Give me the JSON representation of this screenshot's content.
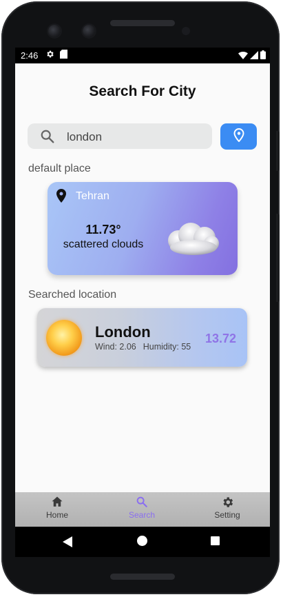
{
  "status": {
    "time": "2:46",
    "left_icons": [
      "gear-icon",
      "sd-card-icon"
    ],
    "right_icons": [
      "wifi-icon",
      "signal-icon",
      "battery-icon"
    ]
  },
  "page": {
    "title": "Search For City"
  },
  "search": {
    "value": "london",
    "icon": "search-icon",
    "location_button_icon": "location-pin-icon"
  },
  "default_place": {
    "section_label": "default place",
    "city": "Tehran",
    "temperature": "11.73°",
    "condition": "scattered clouds",
    "icon": "cloud-icon"
  },
  "searched_location": {
    "section_label": "Searched location",
    "city": "London",
    "wind_label": "Wind: 2.06",
    "humidity_label": "Humidity: 55",
    "temperature": "13.72",
    "icon": "sun-icon"
  },
  "bottom_nav": {
    "items": [
      {
        "label": "Home",
        "icon": "home-icon",
        "active": false
      },
      {
        "label": "Search",
        "icon": "search-icon",
        "active": true
      },
      {
        "label": "Setting",
        "icon": "gear-icon",
        "active": false
      }
    ],
    "active_color": "#8a6ef0"
  },
  "colors": {
    "accent_button": "#3b8cf3",
    "temperature_highlight": "#8f74e6"
  }
}
